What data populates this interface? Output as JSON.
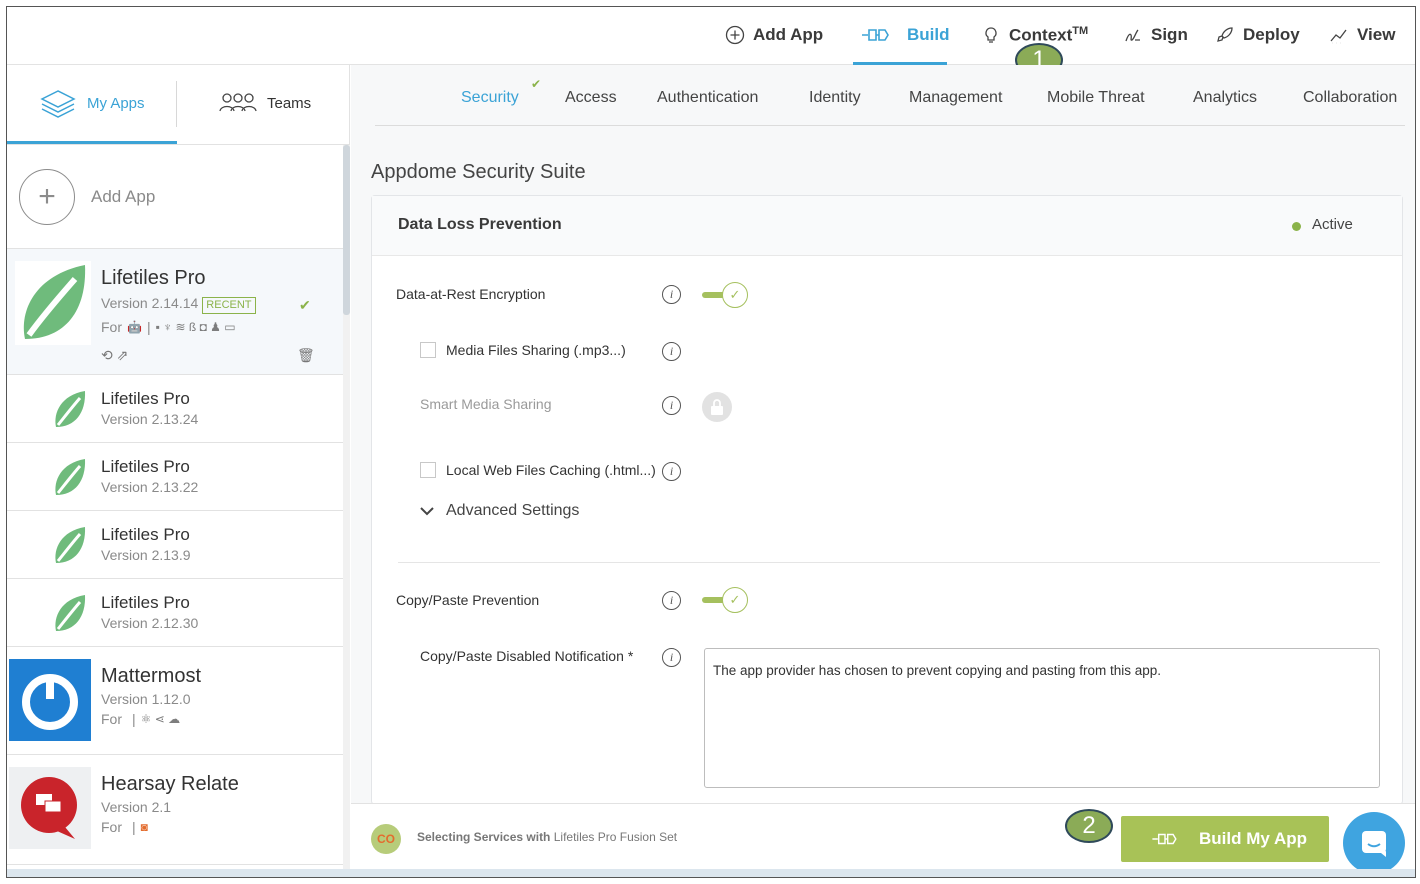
{
  "topnav": {
    "items": [
      {
        "label": "Add App",
        "icon": "plus-circle-icon"
      },
      {
        "label": "Build",
        "icon": "build-plug-icon",
        "active": true
      },
      {
        "label": "Context",
        "icon": "lightbulb-icon",
        "sup": "TM"
      },
      {
        "label": "Sign",
        "icon": "signature-icon"
      },
      {
        "label": "Deploy",
        "icon": "rocket-icon"
      },
      {
        "label": "View",
        "icon": "chart-line-icon"
      }
    ]
  },
  "callouts": {
    "one": "1",
    "two": "2"
  },
  "sidebar": {
    "tabs": [
      {
        "label": "My Apps",
        "icon": "layers-icon",
        "active": true
      },
      {
        "label": "Teams",
        "icon": "team-people-icon"
      }
    ],
    "add_app_label": "Add App",
    "apps": [
      {
        "name": "Lifetiles Pro",
        "version": "Version 2.14.14",
        "badge": "RECENT",
        "for_label": "For",
        "platform": "android-icon",
        "selected": true
      },
      {
        "name": "Lifetiles Pro",
        "version": "Version 2.13.24"
      },
      {
        "name": "Lifetiles Pro",
        "version": "Version 2.13.22"
      },
      {
        "name": "Lifetiles Pro",
        "version": "Version 2.13.9"
      },
      {
        "name": "Lifetiles Pro",
        "version": "Version 2.12.30"
      },
      {
        "name": "Mattermost",
        "version": "Version 1.12.0",
        "for_label": "For",
        "platform": "apple-icon"
      },
      {
        "name": "Hearsay Relate",
        "version": "Version 2.1",
        "for_label": "For",
        "platform": "apple-icon"
      }
    ]
  },
  "subtabs": [
    "Security",
    "Access",
    "Authentication",
    "Identity",
    "Management",
    "Mobile Threat",
    "Analytics",
    "Collaboration"
  ],
  "main": {
    "suite_title": "Appdome Security Suite",
    "card": {
      "title": "Data Loss Prevention",
      "status": "Active",
      "status_color": "#8bb34a",
      "options": {
        "dar": "Data-at-Rest Encryption",
        "media": "Media Files Sharing (.mp3...)",
        "smart": "Smart Media Sharing",
        "web": "Local Web Files Caching (.html...)",
        "advanced": "Advanced Settings",
        "copy": "Copy/Paste Prevention",
        "notif": "Copy/Paste Disabled Notification",
        "notif_required": "*",
        "notif_value": "The app provider has chosen to prevent copying and pasting from this app."
      }
    }
  },
  "footer": {
    "text_bold": "Selecting Services with",
    "text_rest": "Lifetiles Pro Fusion Set",
    "build_button": "Build My App"
  },
  "colors": {
    "accent": "#3ba3d6",
    "green": "#a8c257",
    "chat": "#3fa4e0"
  }
}
